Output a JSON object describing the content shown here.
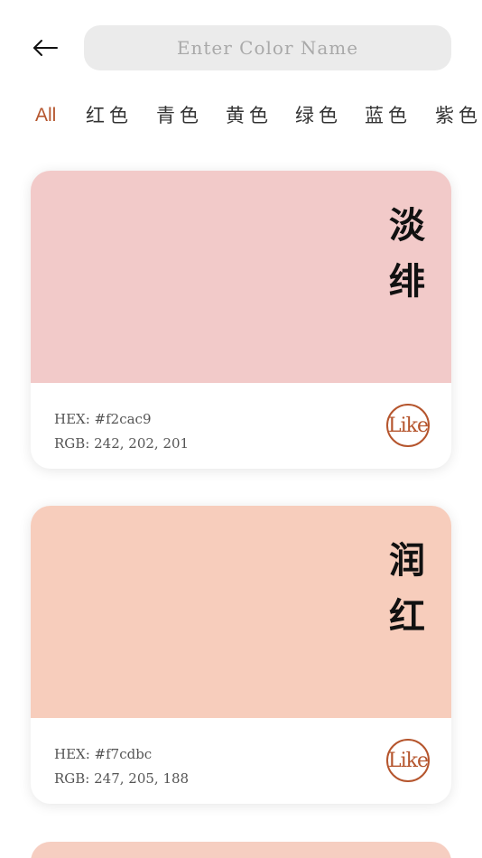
{
  "header": {
    "search_placeholder": "Enter Color Name",
    "search_value": ""
  },
  "filters": [
    {
      "label": "All",
      "active": true
    },
    {
      "label": "红色",
      "active": false
    },
    {
      "label": "青色",
      "active": false
    },
    {
      "label": "黄色",
      "active": false
    },
    {
      "label": "绿色",
      "active": false
    },
    {
      "label": "蓝色",
      "active": false
    },
    {
      "label": "紫色",
      "active": false
    }
  ],
  "cards": [
    {
      "name": "淡绯",
      "hex_text": "HEX: #f2cac9",
      "rgb_text": "RGB: 242, 202, 201",
      "color": "#f2cac9",
      "like_label": "Like"
    },
    {
      "name": "润红",
      "hex_text": "HEX: #f7cdbc",
      "rgb_text": "RGB: 247, 205, 188",
      "color": "#f7cdbc",
      "like_label": "Like"
    }
  ],
  "partial_card": {
    "color": "#f6cec1"
  },
  "colors": {
    "accent": "#b5552d",
    "search_bg": "#ebebeb",
    "placeholder": "#a9a9a9"
  },
  "icons": {
    "back": "arrow-left-icon"
  }
}
